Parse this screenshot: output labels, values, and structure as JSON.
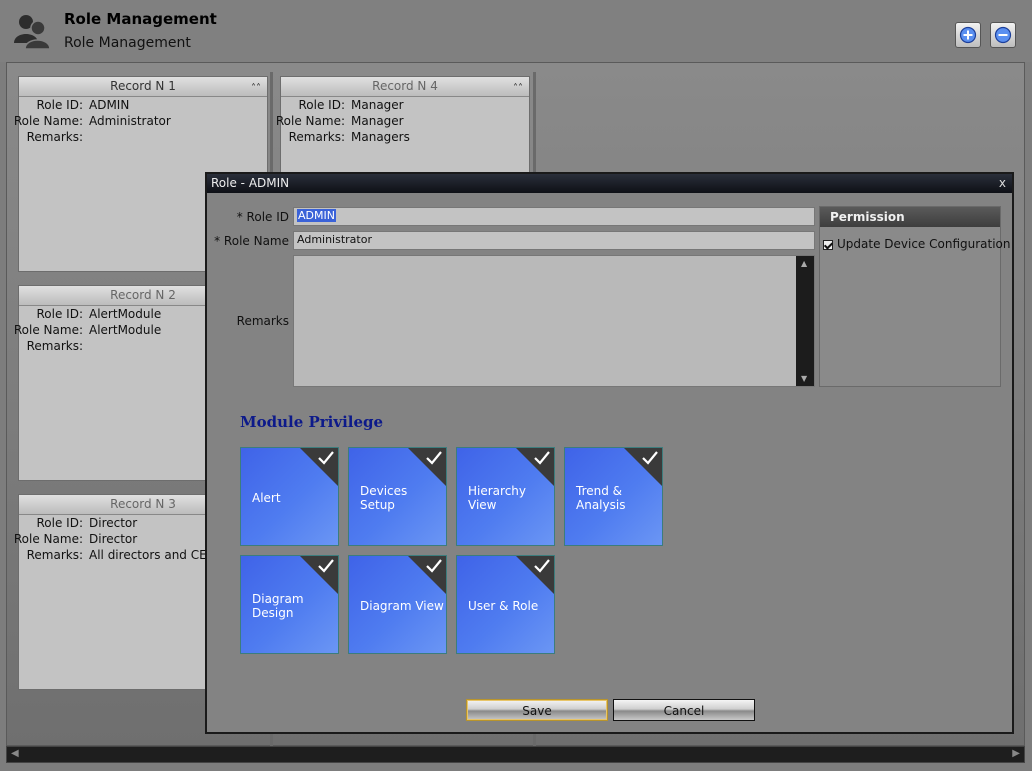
{
  "header": {
    "title": "Role Management",
    "subtitle": "Role Management",
    "icon": "users-icon",
    "add_icon": "plus-circle-icon",
    "remove_icon": "minus-circle-icon"
  },
  "records": [
    {
      "title": "Record N 1",
      "role_id": "ADMIN",
      "role_name": "Administrator",
      "remarks": ""
    },
    {
      "title": "Record N 2",
      "role_id": "AlertModule",
      "role_name": "AlertModule",
      "remarks": ""
    },
    {
      "title": "Record N 3",
      "role_id": "Director",
      "role_name": "Director",
      "remarks": "All directors and CEO"
    },
    {
      "title": "Record N 4",
      "role_id": "Manager",
      "role_name": "Manager",
      "remarks": "Managers"
    }
  ],
  "field_labels": {
    "role_id": "Role ID:",
    "role_name": "Role Name:",
    "remarks": "Remarks:"
  },
  "dialog": {
    "title": "Role - ADMIN",
    "close": "x",
    "role_id_label": "* Role ID",
    "role_id_value": "ADMIN",
    "role_name_label": "* Role Name",
    "role_name_value": "Administrator",
    "remarks_label": "Remarks",
    "remarks_value": "",
    "permission": {
      "header": "Permission",
      "items": [
        {
          "label": "Update Device Configuration",
          "checked": true
        }
      ]
    },
    "module_privilege_title": "Module Privilege",
    "modules": [
      {
        "label": "Alert",
        "checked": true
      },
      {
        "label": "Devices\nSetup",
        "checked": true
      },
      {
        "label": "Hierarchy\nView",
        "checked": true
      },
      {
        "label": "Trend &\nAnalysis",
        "checked": true
      },
      {
        "label": "Diagram\nDesign",
        "checked": true
      },
      {
        "label": "Diagram View",
        "checked": true
      },
      {
        "label": "User & Role",
        "checked": true
      }
    ],
    "save_label": "Save",
    "cancel_label": "Cancel"
  },
  "colors": {
    "tile_blue": "#4f7cf0",
    "module_title": "#0d1a8a",
    "dialog_title_bar": "#14171f",
    "selection": "#3a62d8"
  }
}
